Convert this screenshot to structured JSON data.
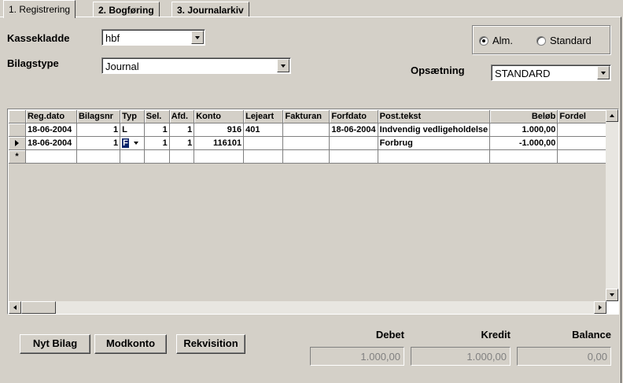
{
  "tabs": [
    {
      "label": "1. Registrering",
      "active": true
    },
    {
      "label": "2. Bogføring",
      "active": false
    },
    {
      "label": "3. Journalarkiv",
      "active": false
    }
  ],
  "form": {
    "kassekladde_label": "Kassekladde",
    "kassekladde_value": "hbf",
    "bilagstype_label": "Bilagstype",
    "bilagstype_value": "Journal",
    "opsaetning_label": "Opsætning",
    "opsaetning_value": "STANDARD",
    "radio_alm": "Alm.",
    "radio_standard": "Standard",
    "radio_selected": "alm"
  },
  "grid": {
    "columns": [
      "Reg.dato",
      "Bilagsnr",
      "Typ",
      "Sel.",
      "Afd.",
      "Konto",
      "Lejeart",
      "Fakturan",
      "Forfdato",
      "Post.tekst",
      "Beløb",
      "Fordel"
    ],
    "rows": [
      [
        "18-06-2004",
        "1",
        "L",
        "1",
        "1",
        "916",
        "401",
        "",
        "18-06-2004",
        "Indvendig vedligeholdelse",
        "1.000,00",
        ""
      ],
      [
        "18-06-2004",
        "1",
        "F",
        "1",
        "1",
        "116101",
        "",
        "",
        "",
        "Forbrug",
        "-1.000,00",
        ""
      ]
    ],
    "new_row_marker": "*"
  },
  "buttons": {
    "nyt_bilag": "Nyt Bilag",
    "modkonto": "Modkonto",
    "rekvisition": "Rekvisition"
  },
  "summary": {
    "debet_label": "Debet",
    "debet_value": "1.000,00",
    "kredit_label": "Kredit",
    "kredit_value": "1.000,00",
    "balance_label": "Balance",
    "balance_value": "0,00"
  },
  "colors": {
    "face": "#d4d0c8",
    "highlight": "#0a246a"
  }
}
